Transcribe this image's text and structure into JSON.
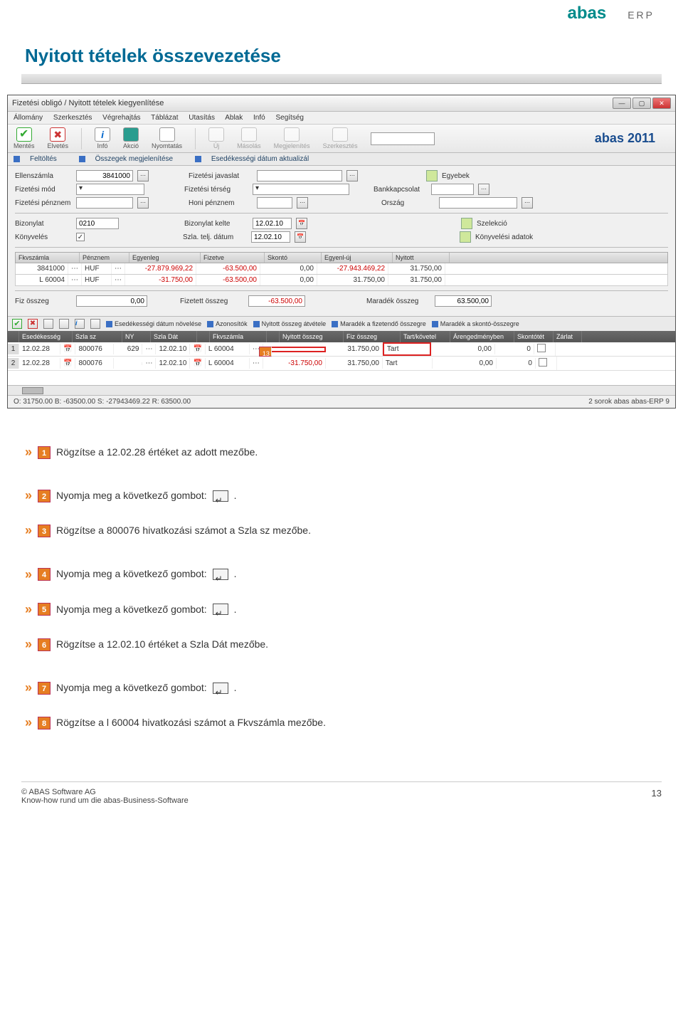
{
  "brand": {
    "name": "abas",
    "sub": "ERP",
    "year": "abas 2011"
  },
  "page_title": "Nyitott tételek összevezetése",
  "window": {
    "title": "Fizetési obligó / Nyitott tételek kiegyenlítése",
    "menus": [
      "Állomány",
      "Szerkesztés",
      "Végrehajtás",
      "Táblázat",
      "Utasítás",
      "Ablak",
      "Infó",
      "Segítség"
    ],
    "tb": {
      "save": "Mentés",
      "discard": "Elvetés",
      "info": "Infó",
      "action": "Akció",
      "print": "Nyomtatás",
      "new": "Új",
      "copy": "Másolás",
      "show": "Megjelenítés",
      "edit": "Szerkesztés"
    },
    "links": [
      "Feltöltés",
      "Összegek megjelenítése",
      "Esedékességi dátum aktualizál"
    ],
    "form": {
      "l_ellenszamla": "Ellenszámla",
      "v_ellenszamla": "3841000",
      "l_fizjav": "Fizetési javaslat",
      "l_egyebek": "Egyebek",
      "l_fizmod": "Fizetési mód",
      "l_fizterseg": "Fizetési térség",
      "l_bank": "Bankkapcsolat",
      "l_fizpenz": "Fizetési pénznem",
      "l_honipenz": "Honi pénznem",
      "l_orszag": "Ország",
      "l_bizonylat": "Bizonylat",
      "v_bizonylat": "0210",
      "l_bizkelte": "Bizonylat kelte",
      "v_bizkelte": "12.02.10",
      "l_szelekcio": "Szelekció",
      "l_konyveles": "Könyvelés",
      "l_szlatelj": "Szla. telj. dátum",
      "v_szlatelj": "12.02.10",
      "l_konyvadat": "Könyvelési adatok"
    },
    "grid1": {
      "headers": [
        "Fkvszámla",
        "Pénznem",
        "Egyenleg",
        "Fizetve",
        "Skontó",
        "Egyenl-új",
        "Nyitott"
      ],
      "rows": [
        {
          "fkv": "3841000",
          "penz": "HUF",
          "egy": "-27.879.969,22",
          "fiz": "-63.500,00",
          "sko": "0,00",
          "eu": "-27.943.469,22",
          "ny": "31.750,00"
        },
        {
          "fkv": "L 60004",
          "penz": "HUF",
          "egy": "-31.750,00",
          "fiz": "-63.500,00",
          "sko": "0,00",
          "eu": "31.750,00",
          "ny": "31.750,00"
        }
      ],
      "sum": {
        "l_fiz": "Fiz összeg",
        "v_fiz": "0,00",
        "l_fizett": "Fizetett összeg",
        "v_fizett": "-63.500,00",
        "l_mar": "Maradék összeg",
        "v_mar": "63.500,00"
      }
    },
    "actions2": [
      "Esedékességi dátum növelése",
      "Azonosítók",
      "Nyitott összeg átvétele",
      "Maradék a fizetendő összegre",
      "Maradék a skontó-összegre"
    ],
    "grid2": {
      "headers": [
        "",
        "Esedékesség",
        "Szla sz",
        "NY",
        "Szla Dát",
        "",
        "Fkvszámla",
        "",
        "Nyitott összeg",
        "Fiz összeg",
        "Tart/követel",
        "Árengedményben",
        "Skontótét",
        "Zárlat"
      ],
      "rows": [
        {
          "n": "1",
          "esed": "12.02.28",
          "szla": "800076",
          "ny": "629",
          "dat": "12.02.10",
          "fkv": "L 60004",
          "nyit": "",
          "fiz": "31.750,00",
          "tk": "Tart",
          "ar": "0,00",
          "sk": "0",
          "z": ""
        },
        {
          "n": "2",
          "esed": "12.02.28",
          "szla": "800076",
          "ny": "",
          "dat": "12.02.10",
          "fkv": "L 60004",
          "nyit": "-31.750,00",
          "fiz": "31.750,00",
          "tk": "Tart",
          "ar": "0,00",
          "sk": "0",
          "z": ""
        }
      ],
      "badge": "13"
    },
    "status": {
      "left": "O: 31750.00  B: -63500.00  S: -27943469.22  R: 63500.00",
      "right": "2 sorok   abas   abas-ERP   9"
    }
  },
  "instructions": [
    {
      "n": "1",
      "t": "Rögzítse a 12.02.28 értéket az adott mezőbe."
    },
    {
      "n": "2",
      "t": "Nyomja meg a következő gombot: ",
      "icon": true,
      "suffix": "."
    },
    {
      "n": "3",
      "t": "Rögzítse a 800076  hivatkozási számot a Szla sz mezőbe."
    },
    {
      "n": "4",
      "t": "Nyomja meg a következő gombot: ",
      "icon": true,
      "suffix": "."
    },
    {
      "n": "5",
      "t": "Nyomja meg a következő gombot: ",
      "icon": true,
      "suffix": "."
    },
    {
      "n": "6",
      "t": "Rögzítse a 12.02.10 értéket a Szla Dát mezőbe."
    },
    {
      "n": "7",
      "t": "Nyomja meg a következő gombot: ",
      "icon": true,
      "suffix": "."
    },
    {
      "n": "8",
      "t": "Rögzítse a l 60004 hivatkozási számot a Fkvszámla mezőbe."
    }
  ],
  "footer": {
    "company": "© ABAS Software AG",
    "tagline": "Know-how rund um die abas-Business-Software",
    "page": "13"
  }
}
